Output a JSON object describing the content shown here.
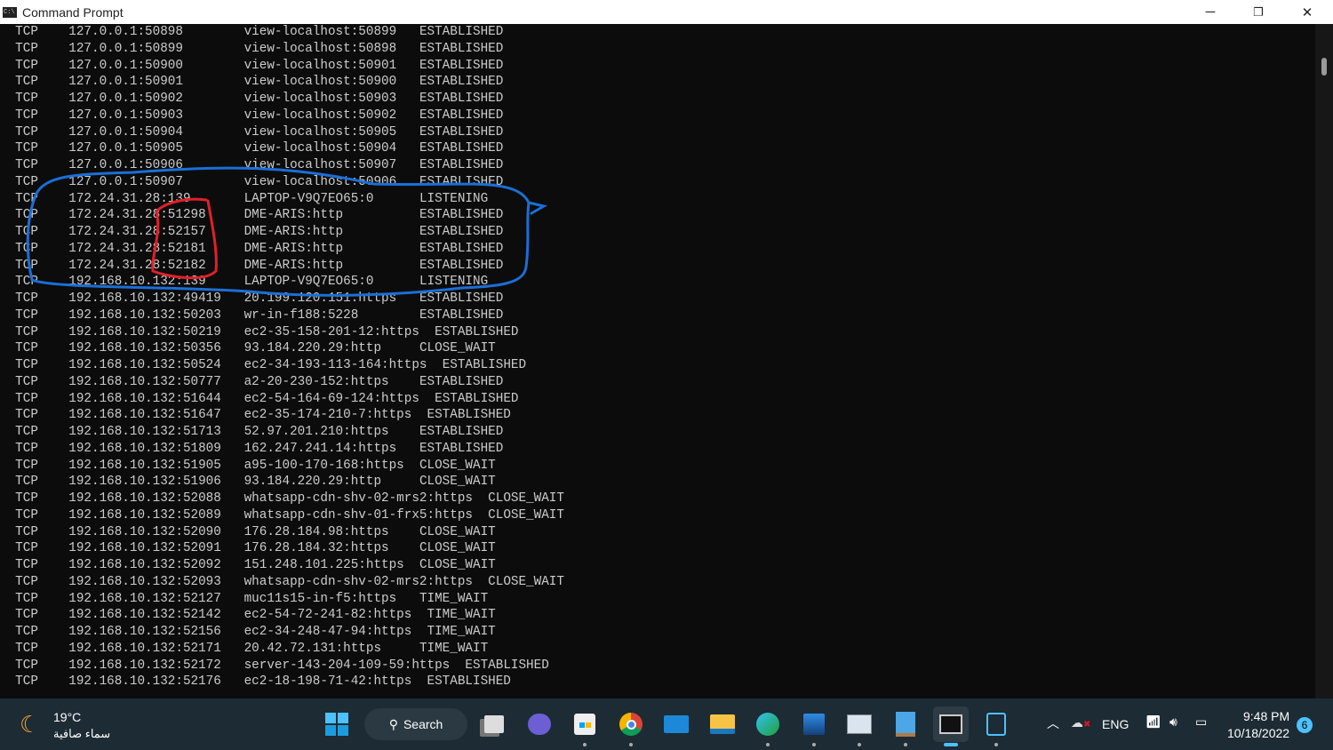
{
  "window": {
    "title": "Command Prompt",
    "minimize": "─",
    "restore": "❐",
    "close": "✕"
  },
  "console_rows": [
    [
      "TCP",
      "127.0.0.1:50898",
      "view-localhost:50899",
      "ESTABLISHED"
    ],
    [
      "TCP",
      "127.0.0.1:50899",
      "view-localhost:50898",
      "ESTABLISHED"
    ],
    [
      "TCP",
      "127.0.0.1:50900",
      "view-localhost:50901",
      "ESTABLISHED"
    ],
    [
      "TCP",
      "127.0.0.1:50901",
      "view-localhost:50900",
      "ESTABLISHED"
    ],
    [
      "TCP",
      "127.0.0.1:50902",
      "view-localhost:50903",
      "ESTABLISHED"
    ],
    [
      "TCP",
      "127.0.0.1:50903",
      "view-localhost:50902",
      "ESTABLISHED"
    ],
    [
      "TCP",
      "127.0.0.1:50904",
      "view-localhost:50905",
      "ESTABLISHED"
    ],
    [
      "TCP",
      "127.0.0.1:50905",
      "view-localhost:50904",
      "ESTABLISHED"
    ],
    [
      "TCP",
      "127.0.0.1:50906",
      "view-localhost:50907",
      "ESTABLISHED"
    ],
    [
      "TCP",
      "127.0.0.1:50907",
      "view-localhost:50906",
      "ESTABLISHED"
    ],
    [
      "TCP",
      "172.24.31.28:139",
      "LAPTOP-V9Q7EO65:0",
      "LISTENING"
    ],
    [
      "TCP",
      "172.24.31.28:51298",
      "DME-ARIS:http",
      "ESTABLISHED"
    ],
    [
      "TCP",
      "172.24.31.28:52157",
      "DME-ARIS:http",
      "ESTABLISHED"
    ],
    [
      "TCP",
      "172.24.31.28:52181",
      "DME-ARIS:http",
      "ESTABLISHED"
    ],
    [
      "TCP",
      "172.24.31.28:52182",
      "DME-ARIS:http",
      "ESTABLISHED"
    ],
    [
      "TCP",
      "192.168.10.132:139",
      "LAPTOP-V9Q7EO65:0",
      "LISTENING"
    ],
    [
      "TCP",
      "192.168.10.132:49419",
      "20.199.120.151:https",
      "ESTABLISHED"
    ],
    [
      "TCP",
      "192.168.10.132:50203",
      "wr-in-f188:5228",
      "ESTABLISHED"
    ],
    [
      "TCP",
      "192.168.10.132:50219",
      "ec2-35-158-201-12:https",
      "ESTABLISHED"
    ],
    [
      "TCP",
      "192.168.10.132:50356",
      "93.184.220.29:http",
      "CLOSE_WAIT"
    ],
    [
      "TCP",
      "192.168.10.132:50524",
      "ec2-34-193-113-164:https",
      "ESTABLISHED"
    ],
    [
      "TCP",
      "192.168.10.132:50777",
      "a2-20-230-152:https",
      "ESTABLISHED"
    ],
    [
      "TCP",
      "192.168.10.132:51644",
      "ec2-54-164-69-124:https",
      "ESTABLISHED"
    ],
    [
      "TCP",
      "192.168.10.132:51647",
      "ec2-35-174-210-7:https",
      "ESTABLISHED"
    ],
    [
      "TCP",
      "192.168.10.132:51713",
      "52.97.201.210:https",
      "ESTABLISHED"
    ],
    [
      "TCP",
      "192.168.10.132:51809",
      "162.247.241.14:https",
      "ESTABLISHED"
    ],
    [
      "TCP",
      "192.168.10.132:51905",
      "a95-100-170-168:https",
      "CLOSE_WAIT"
    ],
    [
      "TCP",
      "192.168.10.132:51906",
      "93.184.220.29:http",
      "CLOSE_WAIT"
    ],
    [
      "TCP",
      "192.168.10.132:52088",
      "whatsapp-cdn-shv-02-mrs2:https",
      "CLOSE_WAIT"
    ],
    [
      "TCP",
      "192.168.10.132:52089",
      "whatsapp-cdn-shv-01-frx5:https",
      "CLOSE_WAIT"
    ],
    [
      "TCP",
      "192.168.10.132:52090",
      "176.28.184.98:https",
      "CLOSE_WAIT"
    ],
    [
      "TCP",
      "192.168.10.132:52091",
      "176.28.184.32:https",
      "CLOSE_WAIT"
    ],
    [
      "TCP",
      "192.168.10.132:52092",
      "151.248.101.225:https",
      "CLOSE_WAIT"
    ],
    [
      "TCP",
      "192.168.10.132:52093",
      "whatsapp-cdn-shv-02-mrs2:https",
      "CLOSE_WAIT"
    ],
    [
      "TCP",
      "192.168.10.132:52127",
      "muc11s15-in-f5:https",
      "TIME_WAIT"
    ],
    [
      "TCP",
      "192.168.10.132:52142",
      "ec2-54-72-241-82:https",
      "TIME_WAIT"
    ],
    [
      "TCP",
      "192.168.10.132:52156",
      "ec2-34-248-47-94:https",
      "TIME_WAIT"
    ],
    [
      "TCP",
      "192.168.10.132:52171",
      "20.42.72.131:https",
      "TIME_WAIT"
    ],
    [
      "TCP",
      "192.168.10.132:52172",
      "server-143-204-109-59:https",
      "ESTABLISHED"
    ],
    [
      "TCP",
      "192.168.10.132:52176",
      "ec2-18-198-71-42:https",
      "ESTABLISHED"
    ]
  ],
  "annotations": {
    "blue": "#1a6fd6",
    "red": "#e0202a"
  },
  "taskbar": {
    "weather": {
      "temp": "19°C",
      "desc": "سماء صافية"
    },
    "search_label": "Search",
    "apps": [
      "start",
      "task-view",
      "teams-chat",
      "microsoft-store",
      "chrome",
      "mail",
      "file-explorer",
      "edge-canary",
      "photos",
      "resource-monitor",
      "notepad",
      "command-prompt",
      "snipping-tool"
    ],
    "language": "ENG",
    "time": "9:48 PM",
    "date": "10/18/2022",
    "notification_count": "6"
  }
}
